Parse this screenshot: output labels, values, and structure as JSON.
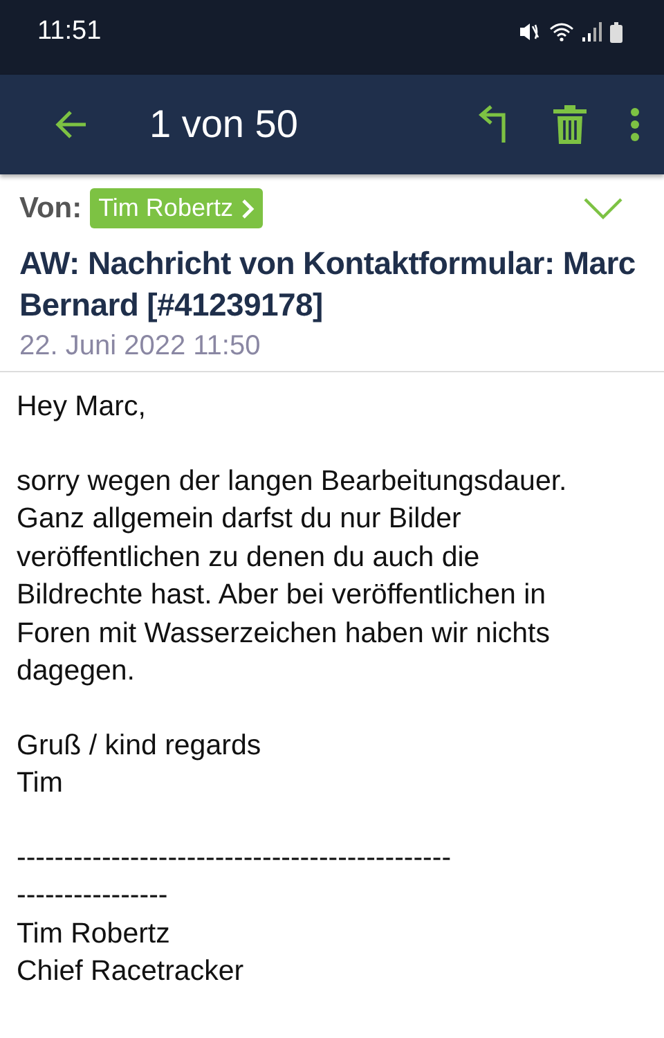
{
  "status_bar": {
    "time": "11:51"
  },
  "app_bar": {
    "title": "1 von 50"
  },
  "header": {
    "from_label": "Von:",
    "sender": "Tim Robertz",
    "expanded": false,
    "subject": "AW: Nachricht von Kontaktformular: Marc Bernard [#41239178]",
    "date": "22. Juni 2022 11:50"
  },
  "body": {
    "paragraphs": [
      [
        "Hey Marc,"
      ],
      [
        "sorry wegen der langen Bearbeitungsdauer.",
        "Ganz allgemein darfst du nur Bilder",
        "veröffentlichen zu denen du auch die",
        "Bildrechte hast. Aber bei veröffentlichen in",
        "Foren mit Wasserzeichen haben wir nichts",
        "dagegen."
      ],
      [
        "Gruß / kind regards",
        "Tim"
      ],
      [
        "----------------------------------------------",
        "----------------",
        "Tim Robertz",
        "Chief Racetracker"
      ]
    ]
  }
}
